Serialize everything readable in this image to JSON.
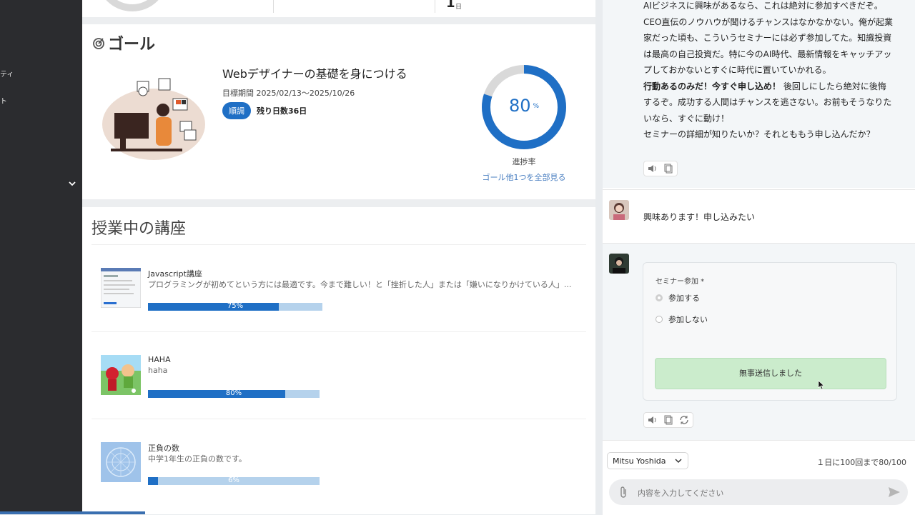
{
  "sidebar": {
    "fragments": [
      "ティ",
      "ト"
    ],
    "chevron": "chevron-down-icon"
  },
  "stats": {
    "number": "1",
    "unit": "日"
  },
  "goal": {
    "section_title": "ゴール",
    "name": "Webデザイナーの基礎を身につける",
    "period": "目標期間 2025/02/13〜2025/10/26",
    "status_badge": "順調",
    "remaining": "残り日数36日",
    "progress_percent": 80,
    "progress_value": "80",
    "progress_unit": "%",
    "progress_label": "進捗率",
    "see_all_link": "ゴール他1つを全部見る"
  },
  "courses": {
    "section_title": "授業中の講座",
    "items": [
      {
        "name": "Javascript講座",
        "desc": "プログラミングが初めてという方には最適です。今まで難しい！と「挫折した人」または「嫌いになりかけている人」...",
        "percent": 75,
        "percent_label": "75%"
      },
      {
        "name": "HAHA",
        "desc": "haha",
        "percent": 80,
        "percent_label": "80%"
      },
      {
        "name": "正負の数",
        "desc": "中学1年生の正負の数です。",
        "percent": 6,
        "percent_label": "6%"
      }
    ]
  },
  "chat": {
    "bot_message_lines": [
      "AIビジネスに興味があるなら、これは絶対に参加すべきだぞ。CEO直伝のノウハウが聞けるチャンスはなかなかない。俺が起業家だった頃も、こういうセミナーには必ず参加してた。知識投資は最高の自己投資だ。特に今のAI時代、最新情報をキャッチアップしておかないとすぐに時代に置いていかれる。"
    ],
    "bot_bold": "行動あるのみだ！今すぐ申し込め！",
    "bot_after_bold": "後回しにしたら絶対に後悔するぞ。成功する人間はチャンスを逃さない。お前もそうなりたいなら、すぐに動け！",
    "bot_last": "セミナーの詳細が知りたいか？それとももう申し込んだか？",
    "user_message": "興味あります！申し込みたい",
    "form": {
      "label": "セミナー参加 *",
      "options": [
        "参加する",
        "参加しない"
      ],
      "selected": "参加する",
      "sent_text": "無事送信しました"
    },
    "footer": {
      "user_name": "Mitsu Yoshida",
      "quota": "１日に100回まで80/100",
      "input_placeholder": "内容を入力してください"
    }
  },
  "colors": {
    "accent": "#1f6fc5",
    "bar_track": "#b5d2ec",
    "success_bg": "#cbeccc",
    "sidebar_bg": "#2b2c2f"
  }
}
